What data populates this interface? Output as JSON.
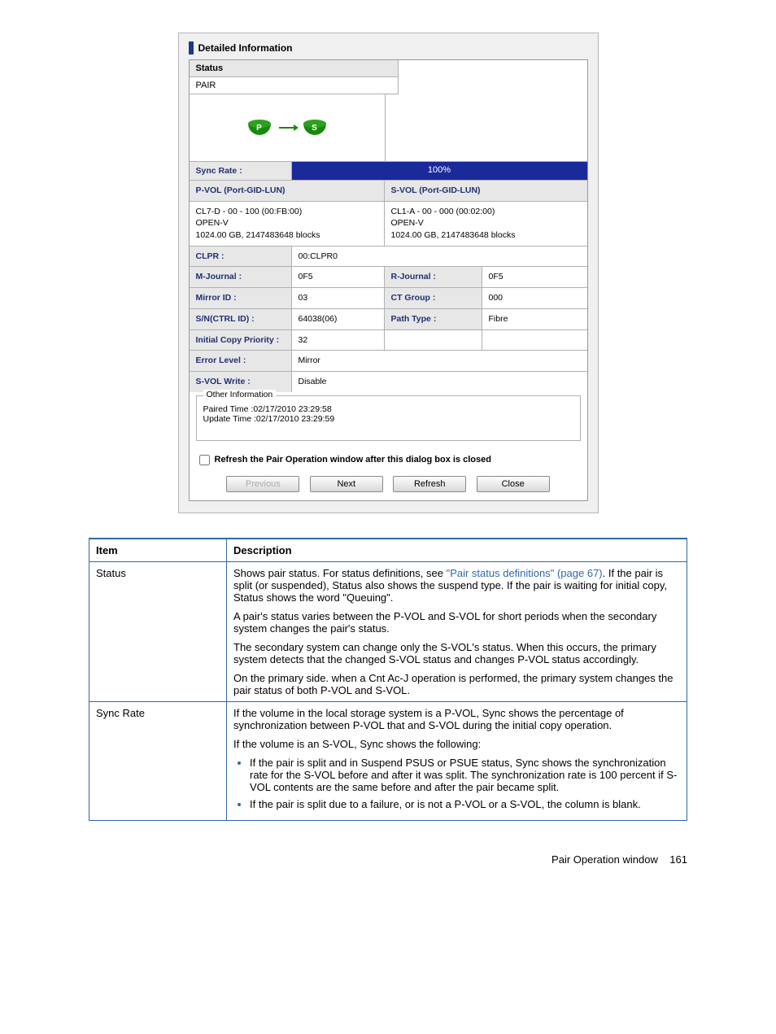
{
  "dialog": {
    "title": "Detailed Information",
    "status_label": "Status",
    "status_value": "PAIR",
    "pvol_letter": "P",
    "svol_letter": "S",
    "sync_rate_label": "Sync Rate :",
    "sync_rate_value": "100%",
    "pvol_header": "P-VOL (Port-GID-LUN)",
    "svol_header": "S-VOL (Port-GID-LUN)",
    "pvol_line1": "CL7-D - 00 - 100 (00:FB:00)",
    "pvol_line2": "OPEN-V",
    "pvol_line3": "1024.00 GB, 2147483648 blocks",
    "svol_line1": "CL1-A - 00 - 000 (00:02:00)",
    "svol_line2": "OPEN-V",
    "svol_line3": "1024.00 GB, 2147483648 blocks",
    "clpr_label": "CLPR :",
    "clpr_value": "00:CLPR0",
    "mjournal_label": "M-Journal :",
    "mjournal_value": "0F5",
    "rjournal_label": "R-Journal :",
    "rjournal_value": "0F5",
    "mirrorid_label": "Mirror ID :",
    "mirrorid_value": "03",
    "ctgroup_label": "CT Group :",
    "ctgroup_value": "000",
    "sn_label": "S/N(CTRL ID) :",
    "sn_value": "64038(06)",
    "pathtype_label": "Path Type :",
    "pathtype_value": "Fibre",
    "initcopy_label": "Initial Copy Priority :",
    "initcopy_value": "32",
    "errlevel_label": "Error Level :",
    "errlevel_value": "Mirror",
    "svolwrite_label": "S-VOL Write :",
    "svolwrite_value": "Disable",
    "other_info_legend": "Other Information",
    "paired_time": "Paired Time :02/17/2010 23:29:58",
    "update_time": "Update Time :02/17/2010 23:29:59",
    "refresh_checkbox_label": "Refresh the Pair Operation window after this dialog box is closed",
    "buttons": {
      "previous": "Previous",
      "next": "Next",
      "refresh": "Refresh",
      "close": "Close"
    }
  },
  "desc_table": {
    "header_item": "Item",
    "header_desc": "Description",
    "rows": [
      {
        "item": "Status",
        "paras": [
          [
            "Shows pair status. For status definitions, see ",
            "\"Pair status definitions\" (page 67)",
            ". If the pair is split (or suspended), Status also shows the suspend type. If the pair is waiting for initial copy, Status shows the word \"Queuing\"."
          ],
          "A pair's status varies between the P-VOL and S-VOL for short periods when the secondary system changes the pair's status.",
          "The secondary system can change only the S-VOL's status. When this occurs, the primary system detects that the changed S-VOL status and changes P-VOL status accordingly.",
          "On the primary side. when a Cnt Ac-J operation is performed, the primary system changes the pair status of both P-VOL and S-VOL."
        ]
      },
      {
        "item": "Sync Rate",
        "paras": [
          "If the volume in the local storage system is a P-VOL, Sync shows the percentage of synchronization between P-VOL that and S-VOL during the initial copy operation.",
          "If the volume is an S-VOL, Sync shows the following:"
        ],
        "bullets": [
          "If the pair is split and in Suspend PSUS or PSUE status, Sync shows the synchronization rate for the S-VOL before and after it was split. The synchronization rate is 100 percent if S-VOL contents are the same before and after the pair became split.",
          "If the pair is split due to a failure, or is not a P-VOL or a S-VOL, the column is blank."
        ]
      }
    ]
  },
  "footer": {
    "text": "Pair Operation window",
    "page": "161"
  }
}
